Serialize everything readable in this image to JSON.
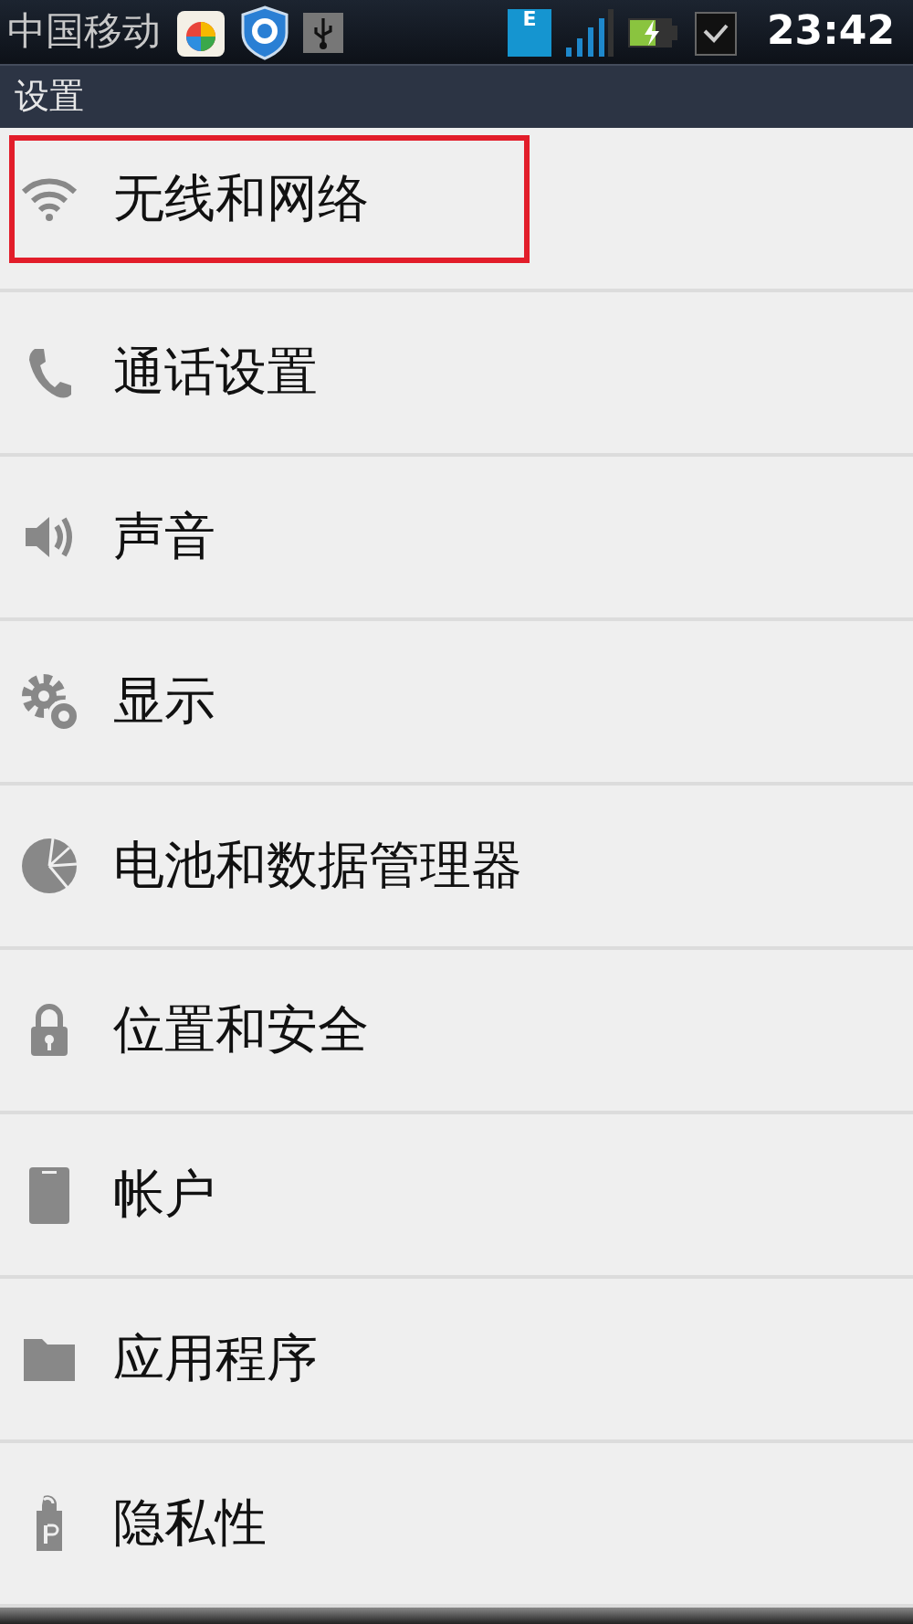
{
  "status_bar": {
    "carrier": "中国移动",
    "network_type": "E",
    "time": "23:42"
  },
  "title_bar": {
    "title": "设置"
  },
  "items": [
    {
      "label": "无线和网络",
      "kind": "wifi",
      "highlighted": true
    },
    {
      "label": "通话设置",
      "kind": "phone",
      "highlighted": false
    },
    {
      "label": "声音",
      "kind": "speaker",
      "highlighted": false
    },
    {
      "label": "显示",
      "kind": "gear",
      "highlighted": false
    },
    {
      "label": "电池和数据管理器",
      "kind": "pie",
      "highlighted": false
    },
    {
      "label": "位置和安全",
      "kind": "lock",
      "highlighted": false
    },
    {
      "label": "帐户",
      "kind": "device",
      "highlighted": false
    },
    {
      "label": "应用程序",
      "kind": "folder",
      "highlighted": false
    },
    {
      "label": "隐私性",
      "kind": "tag",
      "highlighted": false
    }
  ]
}
